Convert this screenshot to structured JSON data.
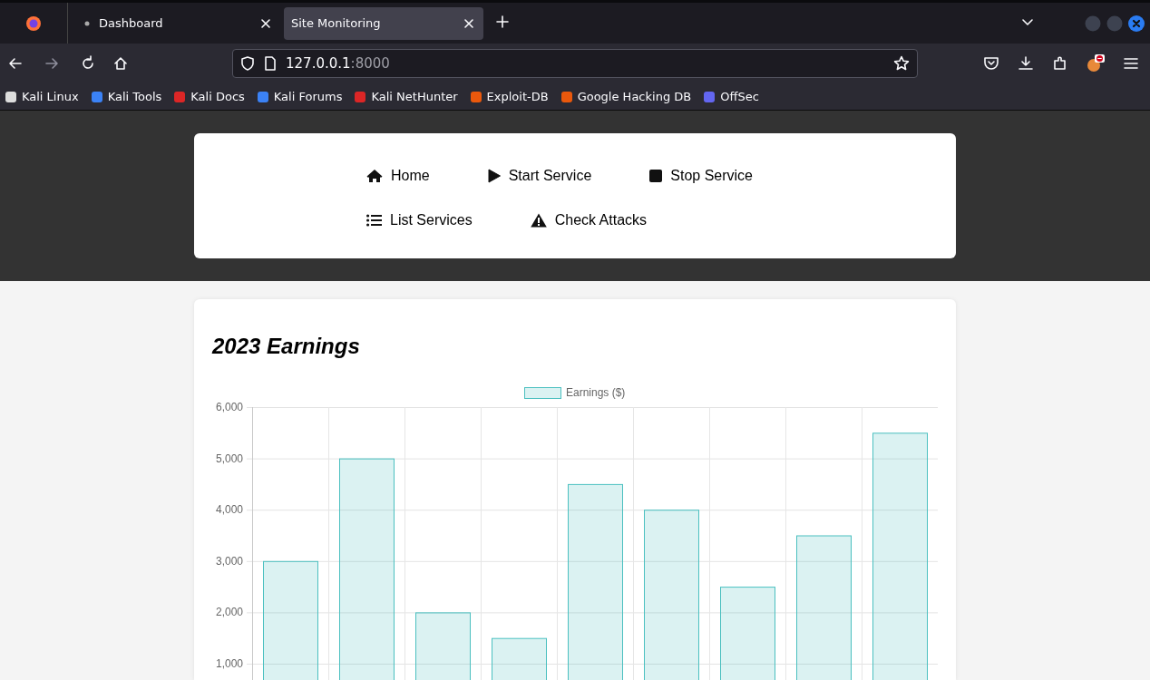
{
  "browser": {
    "tabs": [
      {
        "title": "Dashboard",
        "selected": false
      },
      {
        "title": "Site Monitoring",
        "selected": true
      }
    ],
    "url": {
      "host": "127.0.0.1",
      "port": ":8000"
    },
    "bookmarks": [
      {
        "label": "Kali Linux",
        "color": "#dddddd"
      },
      {
        "label": "Kali Tools",
        "color": "#3b82f6"
      },
      {
        "label": "Kali Docs",
        "color": "#dc2626"
      },
      {
        "label": "Kali Forums",
        "color": "#3b82f6"
      },
      {
        "label": "Kali NetHunter",
        "color": "#dc2626"
      },
      {
        "label": "Exploit-DB",
        "color": "#ea580c"
      },
      {
        "label": "Google Hacking DB",
        "color": "#ea580c"
      },
      {
        "label": "OffSec",
        "color": "#6366f1"
      }
    ]
  },
  "nav": [
    {
      "label": "Home",
      "kind": "home"
    },
    {
      "label": "Start Service",
      "kind": "play"
    },
    {
      "label": "Stop Service",
      "kind": "stop"
    },
    {
      "label": "List Services",
      "kind": "list"
    },
    {
      "label": "Check Attacks",
      "kind": "warning"
    }
  ],
  "earnings": {
    "title": "2023 Earnings",
    "chart_data": {
      "type": "bar",
      "grid": true,
      "series": [
        {
          "name": "Earnings ($)",
          "color": "#4bc0c0",
          "values": [
            3000,
            5000,
            2000,
            1500,
            4500,
            4000,
            2500,
            3500,
            5500
          ]
        }
      ],
      "ylim": [
        0,
        6000
      ],
      "yticks": [
        {
          "value": 1000,
          "label": "1,000"
        },
        {
          "value": 2000,
          "label": "2,000"
        },
        {
          "value": 3000,
          "label": "3,000"
        },
        {
          "value": 4000,
          "label": "4,000"
        },
        {
          "value": 5000,
          "label": "5,000"
        },
        {
          "value": 6000,
          "label": "6,000"
        }
      ]
    }
  }
}
